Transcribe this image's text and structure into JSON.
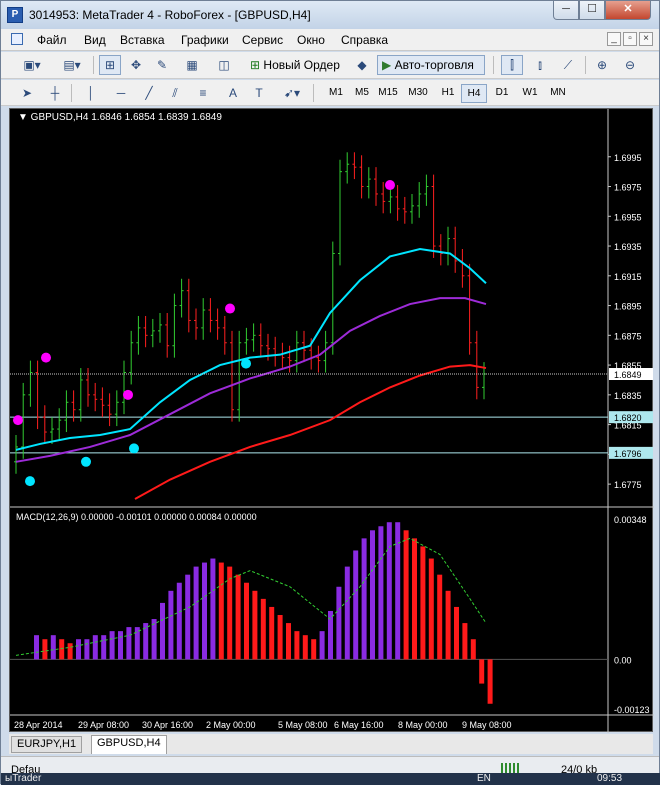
{
  "window": {
    "title": "3014953: MetaTrader 4 - RoboForex - [GBPUSD,H4]",
    "min_glyph": "─",
    "max_glyph": "☐",
    "close_glyph": "✕"
  },
  "menu": [
    "Файл",
    "Вид",
    "Вставка",
    "Графики",
    "Сервис",
    "Окно",
    "Справка"
  ],
  "toolbar": {
    "new_order": "Новый Ордер",
    "auto_trading": "Авто-торговля"
  },
  "timeframes": [
    "M1",
    "M5",
    "M15",
    "M30",
    "H1",
    "H4",
    "D1",
    "W1",
    "MN"
  ],
  "active_timeframe": "H4",
  "chart": {
    "header": "GBPUSD,H4  1.6846 1.6854 1.6839 1.6849",
    "price_ticks": [
      "1.6995",
      "1.6975",
      "1.6955",
      "1.6935",
      "1.6915",
      "1.6895",
      "1.6875",
      "1.6855",
      "1.6835",
      "1.6815",
      "1.6795",
      "1.6775"
    ],
    "current_price": "1.6849",
    "hline1": "1.6820",
    "hline2": "1.6796",
    "macd_header": "MACD(12,26,9) 0.00000 -0.00101 0.00000 0.00084 0.00000",
    "macd_ticks": [
      "0.00348",
      "0.00",
      "-0.00123"
    ],
    "date_labels": [
      "28 Apr 2014",
      "29 Apr 08:00",
      "30 Apr 16:00",
      "2 May 00:00",
      "5 May 08:00",
      "6 May 16:00",
      "8 May 00:00",
      "9 May 08:00"
    ],
    "colors": {
      "bg": "#000000",
      "up": "#32cd32",
      "down": "#ff2020",
      "ma_fast": "#00e5ff",
      "ma_mid": "#9d2bd8",
      "ma_slow": "#ff1a1a",
      "macd_up": "#8a2be2",
      "macd_down": "#ff1a1a",
      "signal": "#32cd32"
    }
  },
  "chart_data": {
    "type": "candlestick",
    "ylim": [
      1.6765,
      1.7015
    ],
    "current_price": 1.6849,
    "macd": {
      "ylim": [
        -0.00123,
        0.00348
      ]
    }
  },
  "tabs": [
    "EURJPY,H1",
    "GBPUSD,H4"
  ],
  "active_tab": "GBPUSD,H4",
  "status": {
    "left": "Defau",
    "right": "24/0 kb"
  },
  "taskbar": {
    "left": "ыTrader",
    "lang": "EN",
    "time": "09:53"
  }
}
